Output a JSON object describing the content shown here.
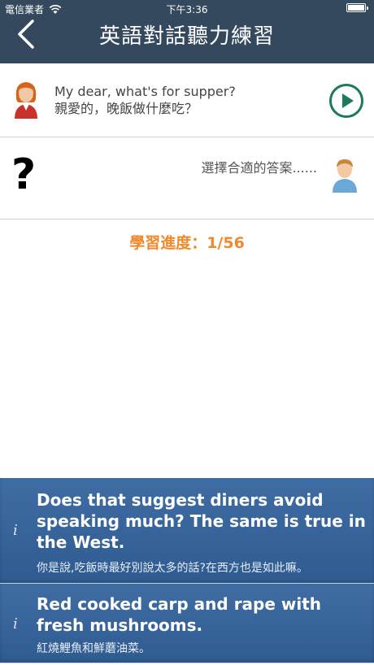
{
  "status": {
    "carrier": "電信業者",
    "time": "下午3:36"
  },
  "header": {
    "title": "英語對話聽力練習"
  },
  "dialogue": {
    "line_en": "My dear, what's for supper?",
    "line_zh": "親愛的，晚飯做什麼吃？",
    "question_mark": "?",
    "prompt": "選擇合適的答案......"
  },
  "progress": {
    "label": "學習進度：1/56",
    "current": 1,
    "total": 56
  },
  "options": [
    {
      "info_icon": "i",
      "text_en": "Does that suggest diners avoid speaking much? The same is true in the West.",
      "text_zh": "你是說,吃飯時最好別說太多的話?在西方也是如此嘛。"
    },
    {
      "info_icon": "i",
      "text_en": "Red cooked carp and rape with fresh mushrooms.",
      "text_zh": "紅燒鯉魚和鮮蘑油菜。"
    }
  ],
  "colors": {
    "header_bg": "#34495e",
    "option_bg": "#3a679c",
    "progress": "#f0892b",
    "play_button": "#1e7a5c"
  },
  "icons": {
    "back": "chevron-left-icon",
    "wifi": "wifi-icon",
    "battery": "battery-icon",
    "play": "play-icon",
    "female_avatar": "female-avatar-icon",
    "male_avatar": "male-avatar-icon",
    "info": "info-icon"
  }
}
